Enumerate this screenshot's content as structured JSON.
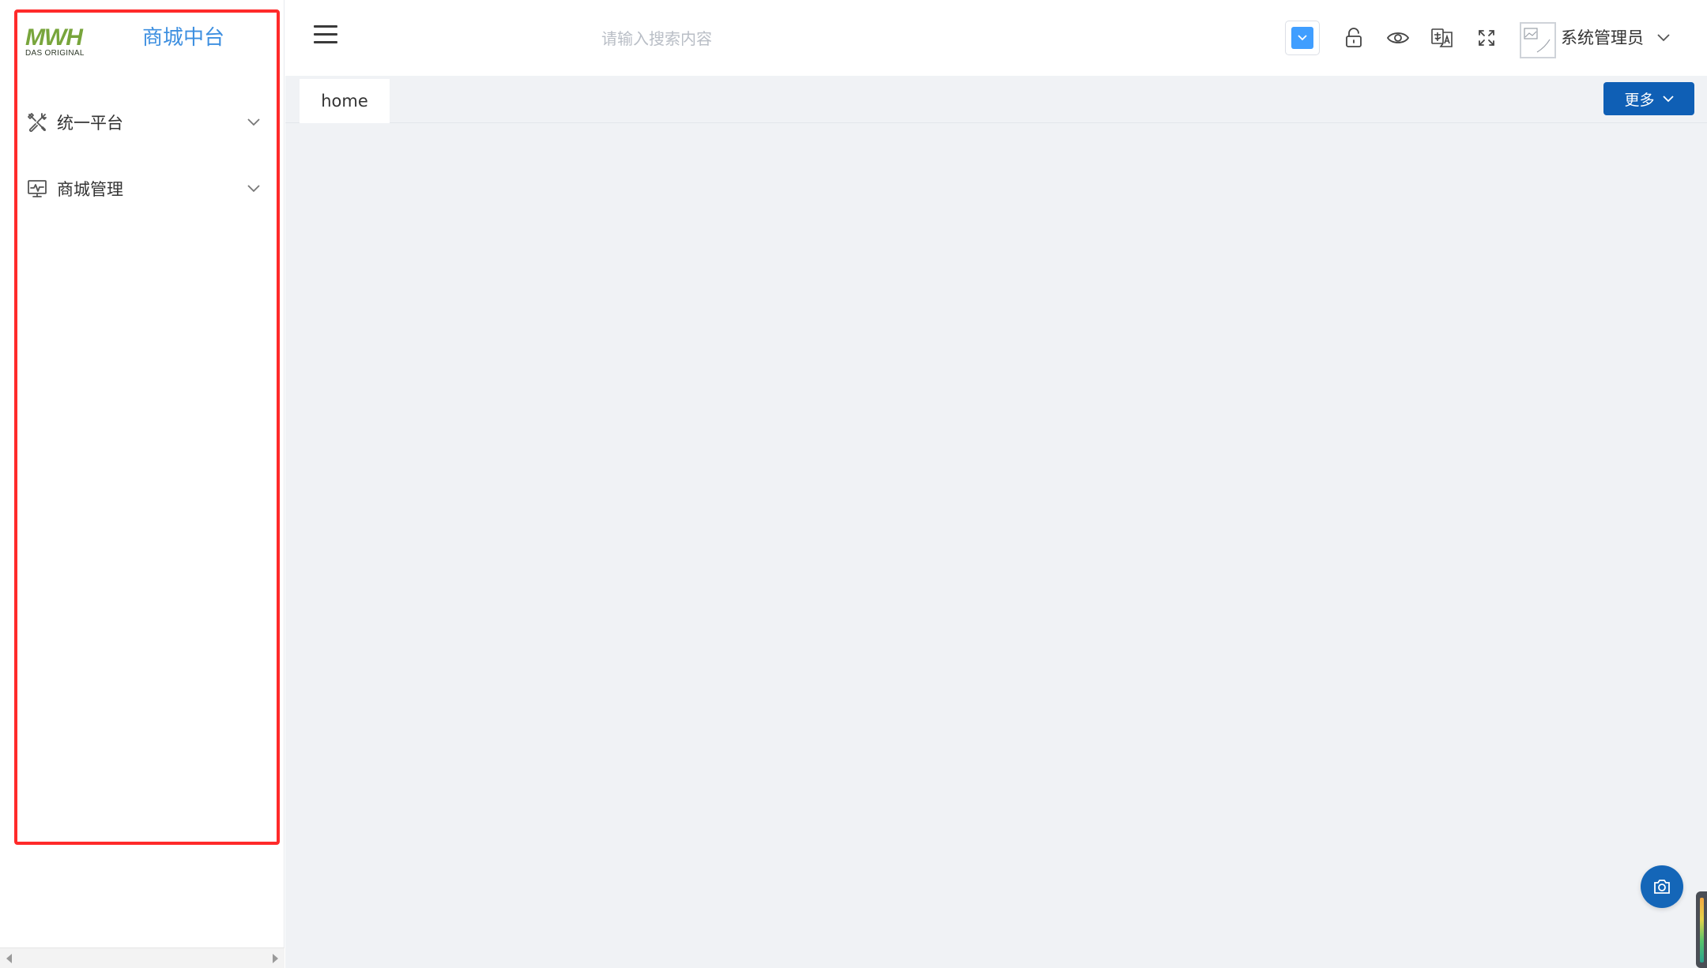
{
  "sidebar": {
    "logo": {
      "mark": "MWH",
      "subtitle": "DAS ORIGINAL"
    },
    "app_title": "商城中台",
    "menu": [
      {
        "label": "统一平台",
        "icon": "tools-icon"
      },
      {
        "label": "商城管理",
        "icon": "monitor-icon"
      }
    ]
  },
  "header": {
    "search_placeholder": "请输入搜索内容",
    "theme_color": "#409eff",
    "user_name": "系统管理员"
  },
  "tabs": [
    {
      "label": "home"
    }
  ],
  "more_button": {
    "label": "更多"
  },
  "colors": {
    "highlight_border": "#ff2a2a",
    "app_title": "#3d8fe0",
    "primary_button": "#0f5fb5",
    "main_background": "#f0f2f5",
    "logo_green": "#78a53c"
  }
}
